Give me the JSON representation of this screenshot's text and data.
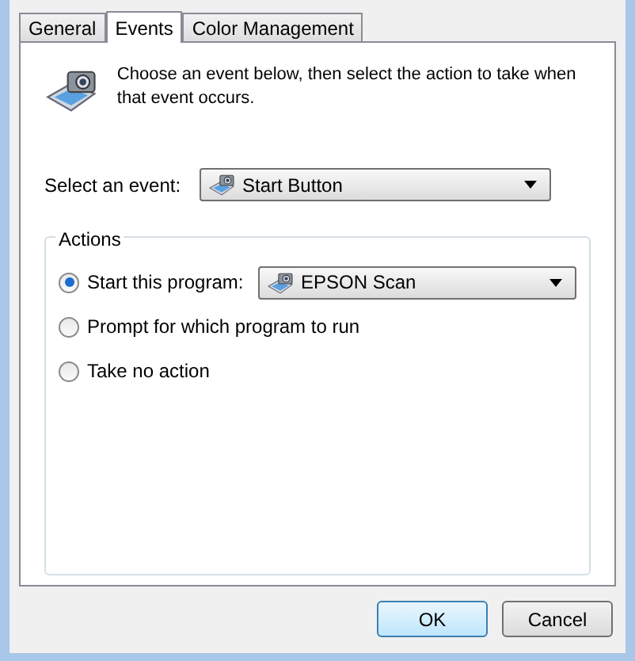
{
  "tabs": [
    {
      "label": "General",
      "selected": false
    },
    {
      "label": "Events",
      "selected": true
    },
    {
      "label": "Color Management",
      "selected": false
    }
  ],
  "intro": "Choose an event below, then select the action to take when that event occurs.",
  "event": {
    "label": "Select an event:",
    "value": "Start Button"
  },
  "actions": {
    "title": "Actions",
    "options": [
      {
        "kind": "program",
        "label": "Start this program:",
        "selected": true,
        "value": "EPSON Scan"
      },
      {
        "kind": "plain",
        "label": "Prompt for which program to run",
        "selected": false
      },
      {
        "kind": "plain",
        "label": "Take no action",
        "selected": false
      }
    ]
  },
  "buttons": [
    {
      "label": "OK",
      "default": true
    },
    {
      "label": "Cancel",
      "default": false
    }
  ]
}
